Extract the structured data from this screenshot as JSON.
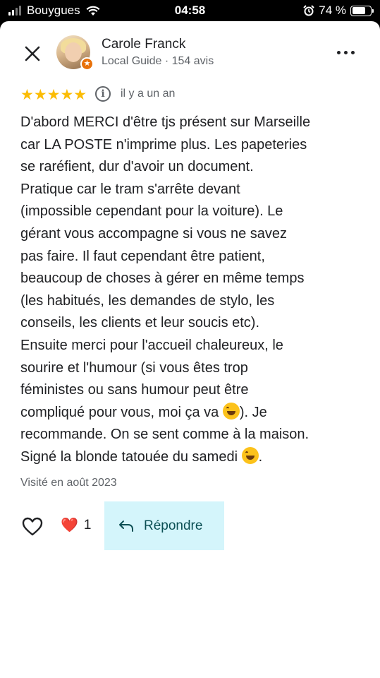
{
  "status_bar": {
    "carrier": "Bouygues",
    "time": "04:58",
    "battery": "74 %",
    "battery_level": 0.74
  },
  "reviewer": {
    "name": "Carole Franck",
    "subtitle": "Local Guide · 154 avis",
    "badge_icon": "local-guide-star"
  },
  "review": {
    "rating": 5,
    "stars": "★★★★★",
    "info": "i",
    "date": "il y a un an",
    "lines": [
      "D'abord MERCI d'être tjs présent sur Marseille",
      "car LA POSTE n'imprime plus. Les papeteries",
      "se raréfient, dur d'avoir un document.",
      "Pratique car le tram s'arrête devant",
      "(impossible cependant pour la voiture). Le",
      "gérant vous accompagne si vous ne savez",
      "pas faire. Il faut cependant être patient,",
      "beaucoup de choses à gérer en même temps",
      "(les habitués, les demandes de stylo, les",
      "conseils, les clients et leur soucis etc).",
      "Ensuite merci pour l'accueil chaleureux, le",
      "sourire et l'humour (si vous êtes trop",
      "féministes ou sans humour peut être",
      "compliqué pour vous, moi ça va ",
      "). Je",
      "recommande. On se sent comme à la maison.",
      "Signé la blonde tatouée du samedi ",
      "."
    ],
    "visited": "Visité en août 2023"
  },
  "actions": {
    "reaction_emoji": "❤️",
    "reaction_count": "1",
    "reply_label": "Répondre"
  },
  "colors": {
    "star": "#fbbc04",
    "badge": "#e8710a",
    "reply_bg": "#d4f5fb",
    "heart": "#d93025"
  }
}
